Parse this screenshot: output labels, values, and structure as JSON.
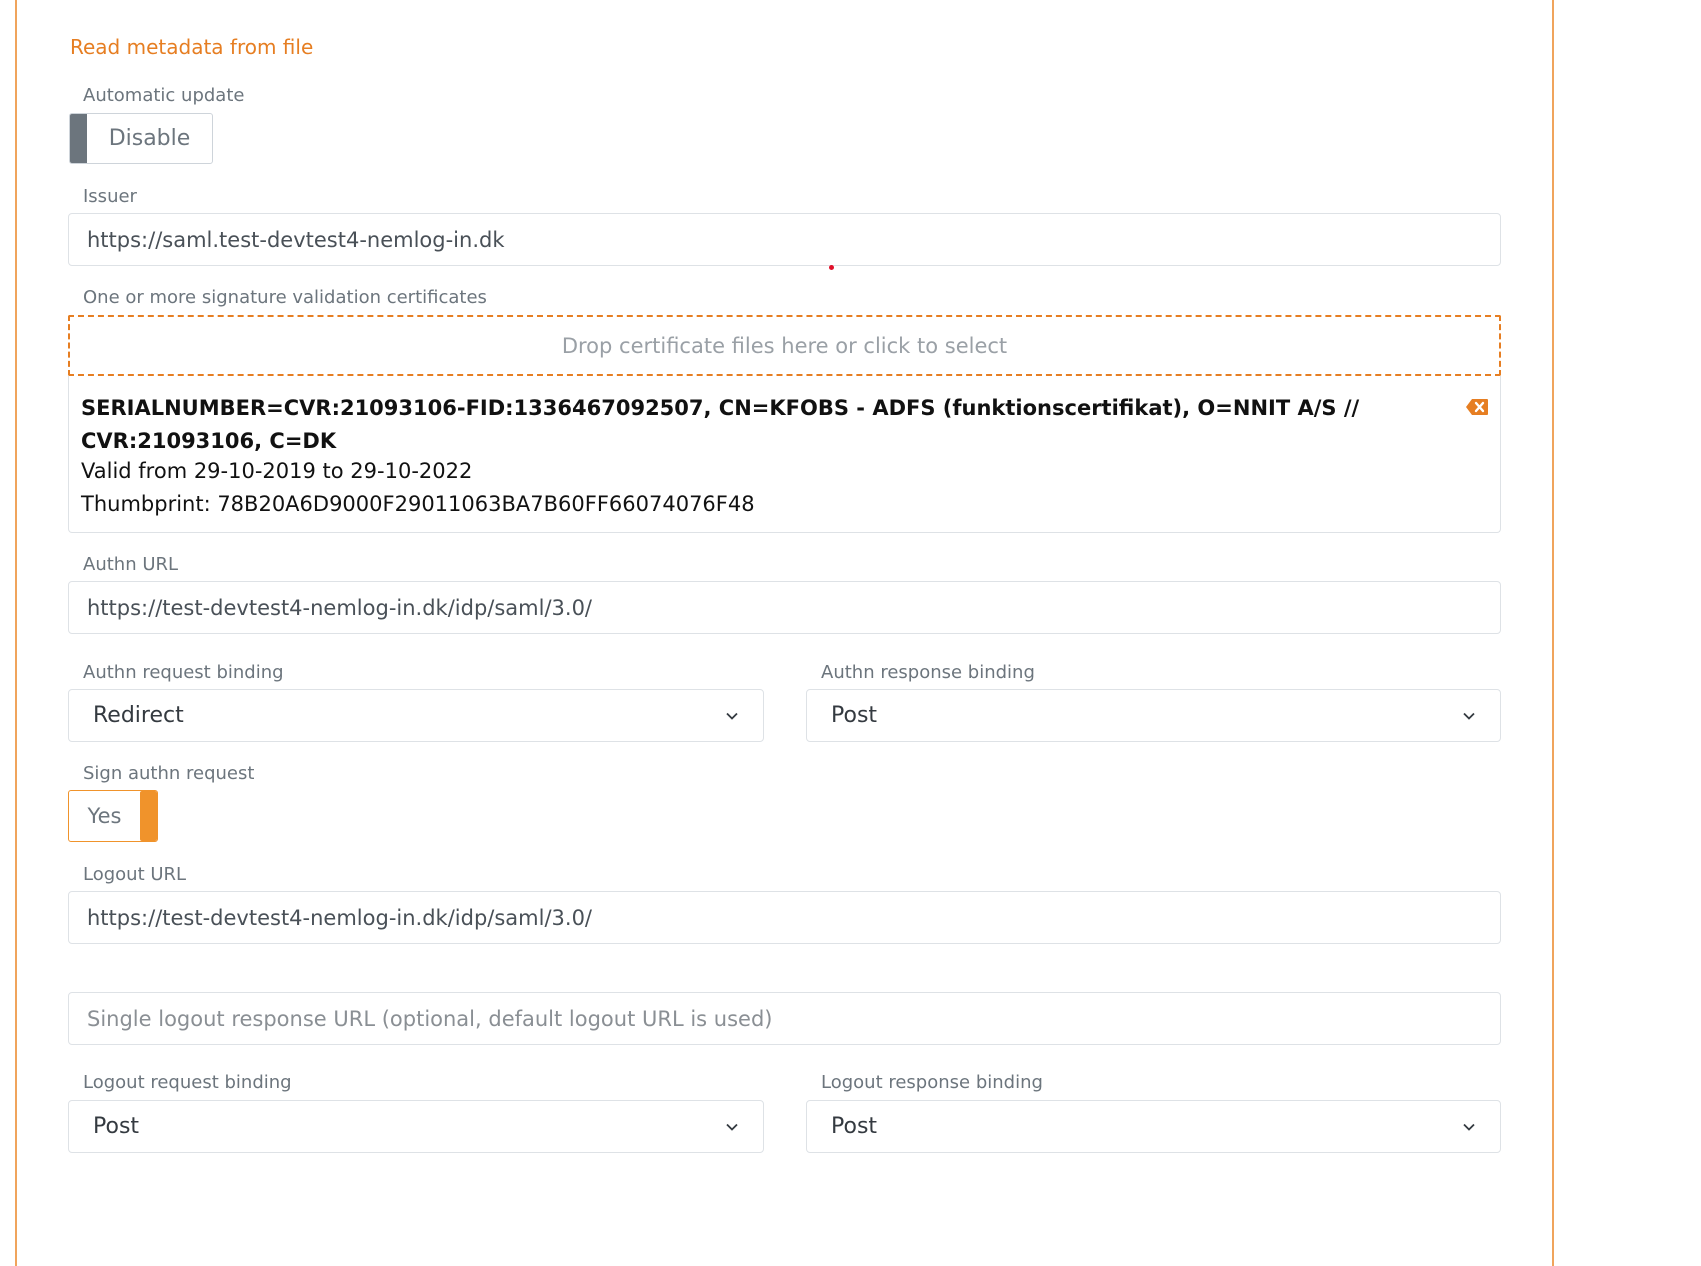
{
  "links": {
    "read_metadata": "Read metadata from file"
  },
  "automatic_update": {
    "label": "Automatic update",
    "state": "Disable"
  },
  "issuer": {
    "label": "Issuer",
    "value": "https://saml.test-devtest4-nemlog-in.dk"
  },
  "certificates": {
    "label": "One or more signature validation certificates",
    "dropzone": "Drop certificate files here or click to select",
    "items": [
      {
        "subject": "SERIALNUMBER=CVR:21093106-FID:1336467092507, CN=KFOBS - ADFS (funktionscertifikat), O=NNIT A/S // CVR:21093106, C=DK",
        "validity": "Valid from 29-10-2019 to 29-10-2022",
        "thumbprint": "Thumbprint: 78B20A6D9000F29011063BA7B60FF66074076F48"
      }
    ]
  },
  "authn_url": {
    "label": "Authn URL",
    "value": "https://test-devtest4-nemlog-in.dk/idp/saml/3.0/"
  },
  "authn_request_binding": {
    "label": "Authn request binding",
    "value": "Redirect"
  },
  "authn_response_binding": {
    "label": "Authn response binding",
    "value": "Post"
  },
  "sign_authn_request": {
    "label": "Sign authn request",
    "state": "Yes"
  },
  "logout_url": {
    "label": "Logout URL",
    "value": "https://test-devtest4-nemlog-in.dk/idp/saml/3.0/"
  },
  "single_logout_response_url": {
    "placeholder": "Single logout response URL (optional, default logout URL is used)"
  },
  "logout_request_binding": {
    "label": "Logout request binding",
    "value": "Post"
  },
  "logout_response_binding": {
    "label": "Logout response binding",
    "value": "Post"
  },
  "colors": {
    "accent": "#e67e22",
    "toggle_on": "#f0932b",
    "toggle_off": "#6c757d"
  }
}
